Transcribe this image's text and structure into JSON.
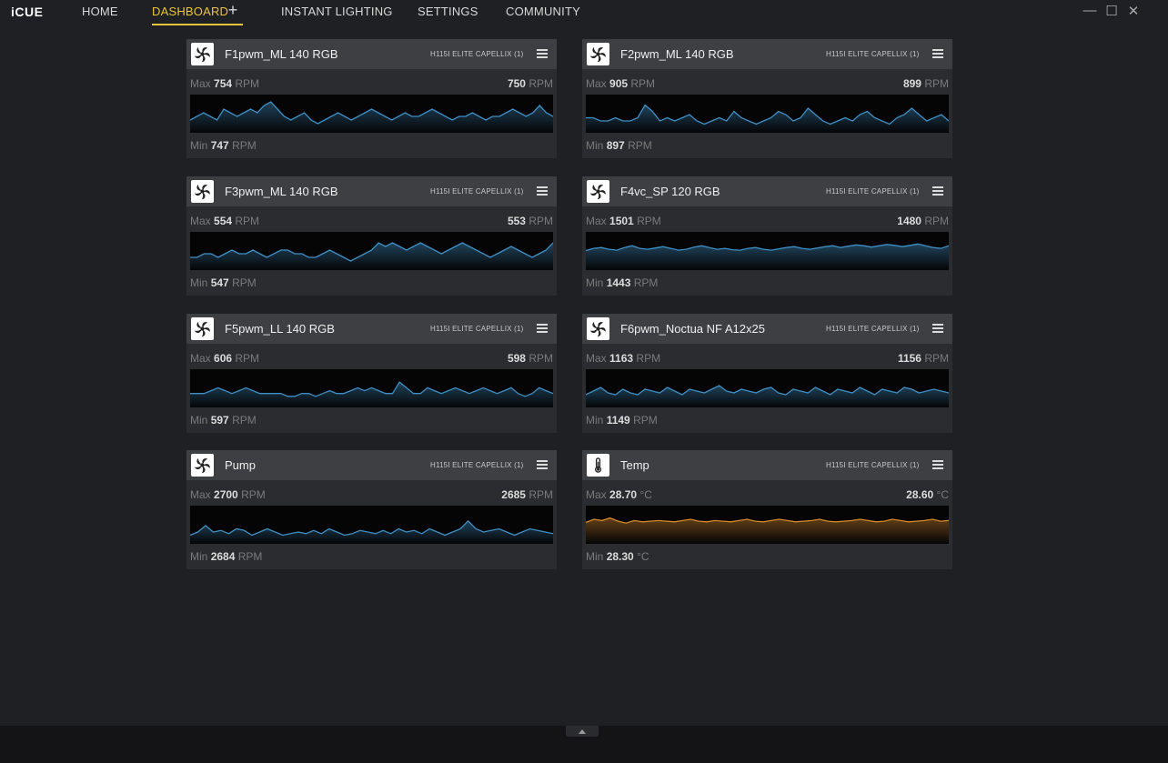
{
  "app": {
    "logo": "iCUE"
  },
  "nav": {
    "home": "HOME",
    "dashboard": "DASHBOARD",
    "add": "+",
    "instant_lighting": "INSTANT LIGHTING",
    "settings": "SETTINGS",
    "community": "COMMUNITY"
  },
  "window": {
    "minimize": "—",
    "maximize": "☐",
    "close": "✕"
  },
  "colors": {
    "accent": "#e8c53a",
    "fan_line": "#3f8fc4",
    "temp_line": "#d4882c"
  },
  "tiles": [
    {
      "name": "F1pwm_ML 140 RGB",
      "device": "H115I ELITE CAPELLIX (1)",
      "icon": "fan-icon",
      "max_label": "Max",
      "max": "754",
      "current": "750",
      "min_label": "Min",
      "min": "747",
      "unit": "RPM",
      "series": [
        749,
        750,
        751,
        750,
        749,
        752,
        751,
        750,
        751,
        752,
        751,
        753,
        754,
        752,
        750,
        749,
        750,
        751,
        749,
        748,
        749,
        750,
        751,
        750,
        749,
        750,
        751,
        752,
        751,
        750,
        749,
        750,
        751,
        750,
        750,
        751,
        752,
        751,
        750,
        749,
        750,
        750,
        751,
        750,
        749,
        750,
        750,
        751,
        752,
        751,
        750,
        751,
        753,
        751,
        750
      ]
    },
    {
      "name": "F2pwm_ML 140 RGB",
      "device": "H115I ELITE CAPELLIX (1)",
      "icon": "fan-icon",
      "max_label": "Max",
      "max": "905",
      "current": "899",
      "min_label": "Min",
      "min": "897",
      "unit": "RPM",
      "series": [
        900,
        900,
        899,
        899,
        900,
        899,
        899,
        900,
        904,
        902,
        899,
        900,
        899,
        900,
        901,
        899,
        898,
        899,
        900,
        899,
        902,
        900,
        899,
        898,
        899,
        900,
        902,
        901,
        899,
        900,
        903,
        901,
        899,
        898,
        899,
        900,
        899,
        901,
        902,
        900,
        899,
        898,
        900,
        901,
        903,
        901,
        899,
        900,
        901,
        899
      ]
    },
    {
      "name": "F3pwm_ML 140 RGB",
      "device": "H115I ELITE CAPELLIX (1)",
      "icon": "fan-icon",
      "max_label": "Max",
      "max": "554",
      "current": "553",
      "min_label": "Min",
      "min": "547",
      "unit": "RPM",
      "series": [
        549,
        549,
        550,
        550,
        549,
        550,
        551,
        550,
        550,
        551,
        550,
        549,
        550,
        551,
        551,
        550,
        550,
        549,
        549,
        550,
        551,
        550,
        549,
        548,
        549,
        550,
        551,
        553,
        552,
        553,
        552,
        551,
        552,
        553,
        552,
        551,
        550,
        551,
        552,
        553,
        552,
        551,
        550,
        549,
        550,
        551,
        552,
        551,
        550,
        549,
        550,
        551,
        553
      ]
    },
    {
      "name": "F4vc_SP 120 RGB",
      "device": "H115I ELITE CAPELLIX (1)",
      "icon": "fan-icon",
      "max_label": "Max",
      "max": "1501",
      "current": "1480",
      "min_label": "Min",
      "min": "1443",
      "unit": "RPM",
      "series": [
        1475,
        1480,
        1482,
        1478,
        1476,
        1482,
        1486,
        1480,
        1478,
        1481,
        1484,
        1480,
        1476,
        1478,
        1483,
        1486,
        1482,
        1478,
        1480,
        1477,
        1476,
        1480,
        1482,
        1478,
        1476,
        1479,
        1482,
        1484,
        1480,
        1478,
        1481,
        1484,
        1486,
        1482,
        1485,
        1488,
        1486,
        1483,
        1486,
        1489,
        1487,
        1484,
        1487,
        1490,
        1486,
        1482,
        1480,
        1486
      ]
    },
    {
      "name": "F5pwm_LL 140 RGB",
      "device": "H115I ELITE CAPELLIX (1)",
      "icon": "fan-icon",
      "max_label": "Max",
      "max": "606",
      "current": "598",
      "min_label": "Min",
      "min": "597",
      "unit": "RPM",
      "series": [
        600,
        600,
        600,
        601,
        602,
        601,
        600,
        601,
        602,
        601,
        600,
        600,
        600,
        600,
        599,
        599,
        600,
        600,
        599,
        600,
        601,
        600,
        600,
        601,
        602,
        601,
        602,
        601,
        600,
        600,
        604,
        602,
        600,
        600,
        602,
        601,
        600,
        601,
        602,
        601,
        600,
        601,
        602,
        601,
        600,
        601,
        602,
        600,
        599,
        600,
        602,
        601,
        600
      ]
    },
    {
      "name": "F6pwm_Noctua NF A12x25",
      "device": "H115I ELITE CAPELLIX (1)",
      "icon": "fan-icon",
      "max_label": "Max",
      "max": "1163",
      "current": "1156",
      "min_label": "Min",
      "min": "1149",
      "unit": "RPM",
      "series": [
        1153,
        1155,
        1157,
        1154,
        1153,
        1156,
        1154,
        1153,
        1156,
        1155,
        1154,
        1157,
        1155,
        1153,
        1156,
        1155,
        1154,
        1156,
        1158,
        1155,
        1154,
        1156,
        1155,
        1154,
        1156,
        1157,
        1154,
        1153,
        1156,
        1155,
        1154,
        1157,
        1155,
        1153,
        1156,
        1155,
        1154,
        1157,
        1155,
        1153,
        1156,
        1155,
        1154,
        1157,
        1156,
        1154,
        1155,
        1156,
        1155,
        1154
      ]
    },
    {
      "name": "Pump",
      "device": "H115I ELITE CAPELLIX (1)",
      "icon": "pump-icon",
      "max_label": "Max",
      "max": "2700",
      "current": "2685",
      "min_label": "Min",
      "min": "2684",
      "unit": "RPM",
      "series": [
        2686,
        2688,
        2692,
        2688,
        2689,
        2687,
        2690,
        2689,
        2686,
        2688,
        2690,
        2688,
        2686,
        2687,
        2688,
        2687,
        2689,
        2687,
        2690,
        2688,
        2686,
        2687,
        2689,
        2688,
        2687,
        2689,
        2687,
        2690,
        2688,
        2689,
        2687,
        2690,
        2688,
        2686,
        2688,
        2690,
        2695,
        2690,
        2688,
        2689,
        2690,
        2688,
        2686,
        2688,
        2690,
        2689,
        2688,
        2687
      ]
    },
    {
      "name": "Temp",
      "device": "H115I ELITE CAPELLIX (1)",
      "icon": "thermometer-icon",
      "max_label": "Max",
      "max": "28.70",
      "current": "28.60",
      "min_label": "Min",
      "min": "28.30",
      "unit": "°C",
      "series": [
        28.55,
        28.6,
        28.58,
        28.62,
        28.57,
        28.54,
        28.58,
        28.56,
        28.57,
        28.58,
        28.57,
        28.56,
        28.58,
        28.6,
        28.57,
        28.56,
        28.58,
        28.57,
        28.56,
        28.58,
        28.6,
        28.57,
        28.56,
        28.58,
        28.6,
        28.58,
        28.56,
        28.57,
        28.58,
        28.6,
        28.57,
        28.56,
        28.57,
        28.58,
        28.6,
        28.58,
        28.56,
        28.57,
        28.6,
        28.58,
        28.56,
        28.57,
        28.58,
        28.6,
        28.57,
        28.58
      ]
    }
  ]
}
